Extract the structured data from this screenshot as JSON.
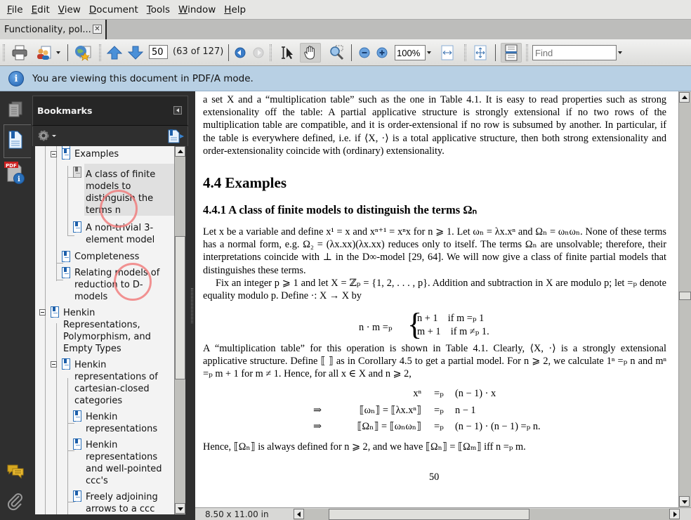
{
  "menubar": {
    "items": [
      {
        "accel": "F",
        "rest": "ile"
      },
      {
        "accel": "E",
        "rest": "dit"
      },
      {
        "accel": "V",
        "rest": "iew"
      },
      {
        "accel": "D",
        "rest": "ocument"
      },
      {
        "accel": "T",
        "rest": "ools"
      },
      {
        "accel": "W",
        "rest": "indow"
      },
      {
        "accel": "H",
        "rest": "elp"
      }
    ]
  },
  "tabs": [
    {
      "label": "Functionality, pol...",
      "close": "✕"
    }
  ],
  "toolbar": {
    "page_number": "50",
    "page_count": "(63 of 127)",
    "zoom_level": "100%",
    "find_placeholder": "Find",
    "buttons": [
      "print",
      "share",
      "collaborate",
      "previous-page",
      "next-page",
      "previous-view",
      "next-view",
      "select-tool",
      "hand-tool",
      "marquee-zoom",
      "zoom-out",
      "zoom-in",
      "fit-width",
      "fit-page",
      "single-page-continuous"
    ]
  },
  "infobar": {
    "icon": "i",
    "message": "You are viewing this document in PDF/A mode."
  },
  "bookmarks": {
    "title": "Bookmarks",
    "items": [
      {
        "label": "Examples",
        "level": 1,
        "expanded": true
      },
      {
        "label": "A class of finite models to distinguish the terms n",
        "level": 2,
        "selected": true
      },
      {
        "label": "A non-trivial 3-element model",
        "level": 2
      },
      {
        "label": "Completeness",
        "level": 1
      },
      {
        "label": "Relating models of reduction to D-models",
        "level": 1
      },
      {
        "label": "Henkin Representations, Polymorphism, and Empty Types",
        "level": 0,
        "expanded": true
      },
      {
        "label": "Henkin representations of cartesian-closed categories",
        "level": 1,
        "expanded": true
      },
      {
        "label": "Henkin representations",
        "level": 2
      },
      {
        "label": "Henkin representations and well-pointed ccc's",
        "level": 2
      },
      {
        "label": "Freely adjoining arrows to a ccc",
        "level": 2
      }
    ]
  },
  "document": {
    "para1": "a set X and a “multiplication table” such as the one in Table 4.1. It is easy to read properties such as strong extensionality off the table: A partial applicative structure is strongly extensional if no two rows of the multiplication table are compatible, and it is order-extensional if no row is subsumed by another. In particular, if the table is everywhere defined, i.e. if ⟨X, ·⟩ is a total applicative structure, then both strong extensionality and order-extensionality coincide with (ordinary) extensionality.",
    "section": "4.4   Examples",
    "subsection": "4.4.1   A class of finite models to distinguish the terms Ωₙ",
    "para2": "Let x be a variable and define x¹ = x and xⁿ⁺¹ = xⁿx for n ⩾ 1. Let ωₙ = λx.xⁿ and Ωₙ = ωₙωₙ. None of these terms has a normal form, e.g. Ω₂ = (λx.xx)(λx.xx) reduces only to itself. The terms Ωₙ are unsolvable; therefore, their interpretations coincide with ⊥ in the D∞-model [29, 64]. We will now give a class of finite partial models that distinguishes these terms.",
    "para3": "Fix an integer p ⩾ 1 and let X = ℤₚ = {1, 2, . . . , p}. Addition and subtraction in X are modulo p; let =ₚ denote equality modulo p. Define ·: X → X by",
    "eq1_lhs": "n · m =ₚ",
    "eq1_case1": "n + 1    if m =ₚ 1",
    "eq1_case2": "m + 1    if m ≠ₚ 1.",
    "para4": "A “multiplication table” for this operation is shown in Table 4.1. Clearly, ⟨X, ·⟩ is a strongly extensional applicative structure. Define ⟦ ⟧ as in Corollary 4.5 to get a partial model. For n ⩾ 2, we calculate 1ⁿ =ₚ n and mⁿ =ₚ m + 1 for m ≠ 1. Hence, for all x ∈ X and n ⩾ 2,",
    "eq2": [
      {
        "pre": "",
        "lhs": "xⁿ",
        "rel": "=ₚ",
        "rhs": "(n − 1) · x"
      },
      {
        "pre": "⇒",
        "lhs": "⟦ωₙ⟧ = ⟦λx.xⁿ⟧",
        "rel": "=ₚ",
        "rhs": "n − 1"
      },
      {
        "pre": "⇒",
        "lhs": "⟦Ωₙ⟧ = ⟦ωₙωₙ⟧",
        "rel": "=ₚ",
        "rhs": "(n − 1) · (n − 1) =ₚ n."
      }
    ],
    "para5": "Hence, ⟦Ωₙ⟧ is always defined for n ⩾ 2, and we have ⟦Ωₙ⟧ = ⟦Ωₘ⟧ iff n =ₚ m.",
    "page_number": "50"
  },
  "status": {
    "page_size": "8.50 x 11.00 in"
  }
}
